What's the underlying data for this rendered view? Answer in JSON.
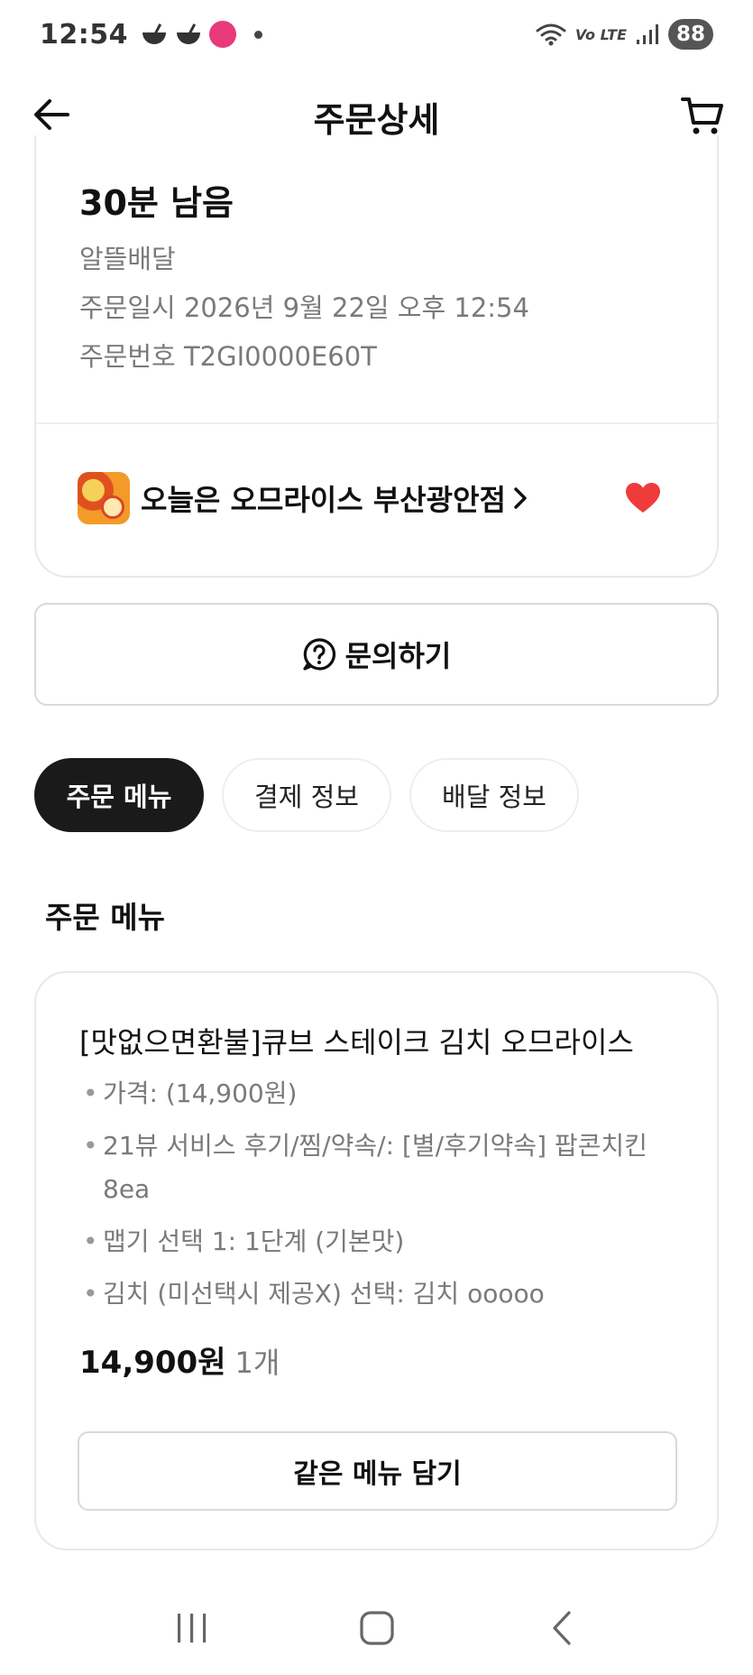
{
  "status_bar": {
    "time": "12:54",
    "network_label": "Vo LTE",
    "battery": "88",
    "notification_icons": [
      "bowl-icon",
      "bowl-icon",
      "app-icon",
      "dot-icon"
    ]
  },
  "header": {
    "title": "주문상세",
    "back_icon": "arrow-left-icon",
    "cart_icon": "cart-icon"
  },
  "order": {
    "remaining_time": "30분 남음",
    "delivery_type": "알뜰배달",
    "order_datetime": "주문일시 2026년 9월 22일 오후 12:54",
    "order_number": "주문번호 T2GI0000E60T",
    "store_name": "오늘은 오므라이스 부산광안점",
    "favorite": true
  },
  "inquiry": {
    "label": "문의하기",
    "icon": "question-circle-icon"
  },
  "tabs": [
    {
      "label": "주문 메뉴",
      "active": true
    },
    {
      "label": "결제 정보",
      "active": false
    },
    {
      "label": "배달 정보",
      "active": false
    }
  ],
  "section_title": "주문 메뉴",
  "menu_item": {
    "name": "[맛없으면환불]큐브 스테이크 김치 오므라이스",
    "options": [
      "가격:  (14,900원)",
      "21뷰 서비스 후기/찜/약속/: [별/후기약속] 팝콘치킨 8ea",
      "맵기 선택 1: 1단계 (기본맛)",
      "김치 (미선택시 제공X) 선택: 김치 ooooo"
    ],
    "price": "14,900원",
    "quantity": "1개",
    "reorder_label": "같은 메뉴 담기"
  },
  "colors": {
    "heart": "#f03b3b",
    "tab_active_bg": "#1a1a1a",
    "muted_text": "#7a7a7a",
    "border": "#d9d9d9"
  },
  "nav_bar": {
    "icons": [
      "recent-apps-icon",
      "home-icon",
      "back-icon"
    ]
  }
}
